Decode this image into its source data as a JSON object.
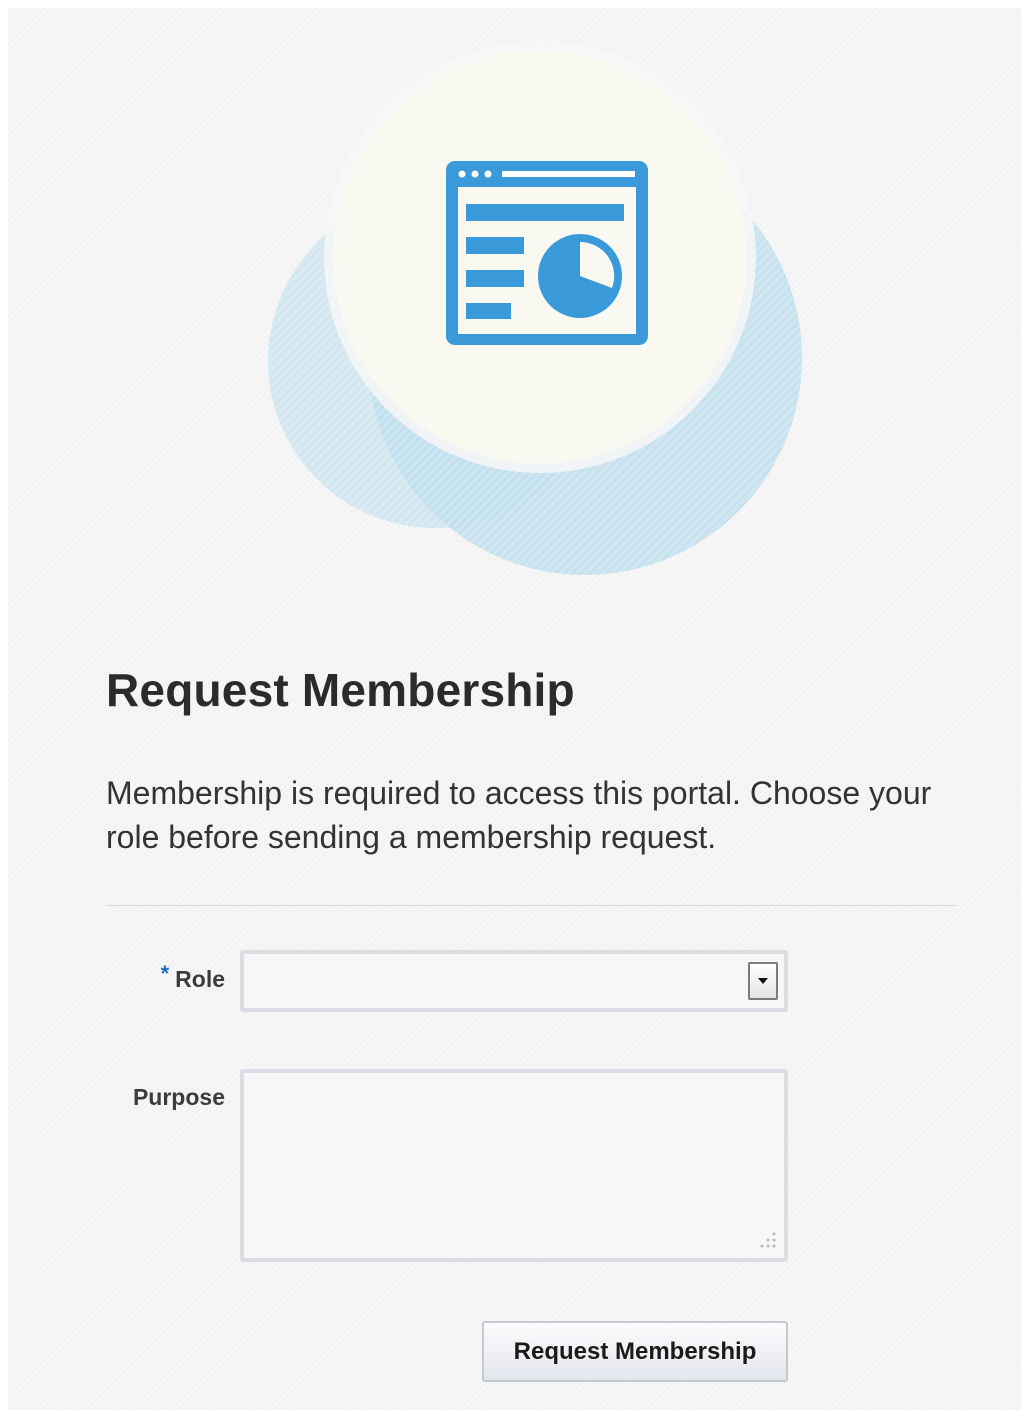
{
  "page": {
    "title": "Request Membership",
    "description": "Membership is required to access this portal. Choose your role before sending a membership request."
  },
  "form": {
    "role": {
      "required_marker": "*",
      "label": "Role",
      "value": ""
    },
    "purpose": {
      "label": "Purpose",
      "value": "",
      "placeholder": ""
    },
    "submit_label": "Request Membership"
  },
  "illustration": {
    "icon": "portal-dashboard-icon",
    "icon_color": "#3a9ad9",
    "accent_circle_color": "#b7dcec",
    "backdrop_circle_color": "#f9f9f4"
  }
}
